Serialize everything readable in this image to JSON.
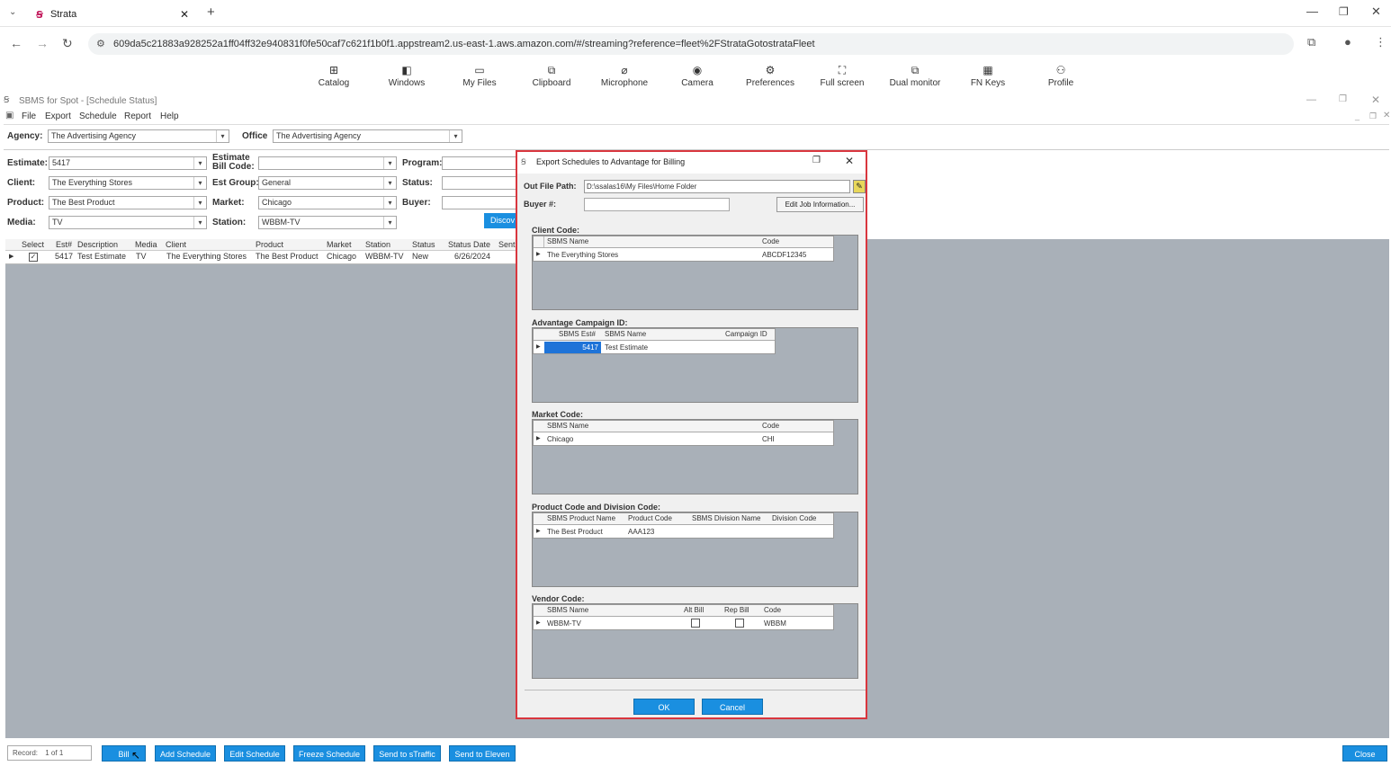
{
  "browser": {
    "tab_title": "Strata",
    "new_tab": "+",
    "url": "609da5c21883a928252a1ff04ff32e940831f0fe50caf7c621f1b0f1.appstream2.us-east-1.aws.amazon.com/#/streaming?reference=fleet%2FStrataGotostrataFleet"
  },
  "toolbar": [
    "Catalog",
    "Windows",
    "My Files",
    "Clipboard",
    "Microphone",
    "Camera",
    "Preferences",
    "Full screen",
    "Dual monitor",
    "FN Keys",
    "Profile"
  ],
  "app": {
    "title": "SBMS for Spot - [Schedule Status]",
    "menu": [
      "File",
      "Export",
      "Schedule",
      "Report",
      "Help"
    ],
    "agency_label": "Agency:",
    "agency_value": "The Advertising Agency",
    "office_label": "Office",
    "office_value": "The Advertising Agency",
    "estimate_label": "Estimate:",
    "estimate_value": "5417",
    "est_bill_code_label": "Estimate Bill Code:",
    "program_label": "Program:",
    "client_label": "Client:",
    "client_value": "The Everything Stores",
    "est_group_label": "Est Group:",
    "est_group_value": "General",
    "status_label": "Status:",
    "product_label": "Product:",
    "product_value": "The Best Product",
    "market_label": "Market:",
    "market_value": "Chicago",
    "buyer_label": "Buyer:",
    "media_label": "Media:",
    "media_value": "TV",
    "station_label": "Station:",
    "station_value": "WBBM-TV",
    "discover_button": "Discov",
    "grid_headers": [
      "Select",
      "Est#",
      "Description",
      "Media",
      "Client",
      "Product",
      "Market",
      "Station",
      "Status",
      "Status Date",
      "Sent"
    ],
    "grid_row": [
      "5417",
      "Test Estimate",
      "TV",
      "The Everything Stores",
      "The Best Product",
      "Chicago",
      "WBBM-TV",
      "New",
      "6/26/2024"
    ],
    "record_label": "Record:",
    "record_value": "1 of 1",
    "buttons": {
      "bill": "Bill",
      "add_schedule": "Add Schedule",
      "edit_schedule": "Edit Schedule",
      "freeze_schedule": "Freeze Schedule",
      "send_traffic": "Send to sTraffic",
      "send_eleven": "Send to Eleven",
      "close": "Close"
    }
  },
  "dialog": {
    "title": "Export Schedules to Advantage for Billing",
    "out_file_label": "Out File Path:",
    "out_file_value": "D:\\ssalas16\\My Files\\Home Folder",
    "buyer_label": "Buyer #:",
    "edit_job_button": "Edit Job Information...",
    "client_code": {
      "label": "Client Code:",
      "headers": [
        "SBMS Name",
        "Code"
      ],
      "row": [
        "The Everything Stores",
        "ABCDF12345"
      ]
    },
    "campaign": {
      "label": "Advantage Campaign ID:",
      "headers": [
        "SBMS Est#",
        "SBMS Name",
        "Campaign ID"
      ],
      "row": [
        "5417",
        "Test Estimate",
        ""
      ]
    },
    "market_code": {
      "label": "Market Code:",
      "headers": [
        "SBMS Name",
        "Code"
      ],
      "row": [
        "Chicago",
        "CHI"
      ]
    },
    "product_code": {
      "label": "Product Code and Division Code:",
      "headers": [
        "SBMS Product Name",
        "Product Code",
        "SBMS Division Name",
        "Division Code"
      ],
      "row": [
        "The Best Product",
        "AAA123",
        "",
        ""
      ]
    },
    "vendor_code": {
      "label": "Vendor Code:",
      "headers": [
        "SBMS Name",
        "Alt Bill",
        "Rep Bill",
        "Code"
      ],
      "row": [
        "WBBM-TV",
        "",
        "",
        "WBBM"
      ]
    },
    "ok_button": "OK",
    "cancel_button": "Cancel"
  },
  "colors": {
    "accent": "#1a8fe0",
    "highlight": "#d9363e",
    "panel_gray": "#a9b0b8",
    "selection": "#1e73d8"
  }
}
